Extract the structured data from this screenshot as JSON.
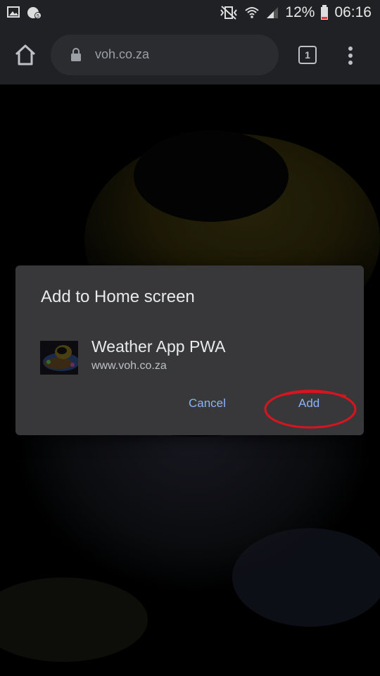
{
  "status_bar": {
    "battery_percent": "12%",
    "time": "06:16",
    "icons": [
      "gallery-icon",
      "whatsapp-icon",
      "mute-vibrate-icon",
      "wifi-icon",
      "signal-icon",
      "battery-icon"
    ]
  },
  "toolbar": {
    "url": "voh.co.za",
    "tab_count": "1",
    "icons": [
      "home-icon",
      "lock-icon",
      "more-vert-icon"
    ]
  },
  "dialog": {
    "title": "Add to Home screen",
    "app_name": "Weather App PWA",
    "app_url": "www.voh.co.za",
    "cancel_label": "Cancel",
    "add_label": "Add"
  },
  "colors": {
    "chrome_bar": "#202124",
    "dialog_bg": "#38383b",
    "accent_button": "#8ab4f8",
    "highlight_annotation": "#d9141f"
  }
}
